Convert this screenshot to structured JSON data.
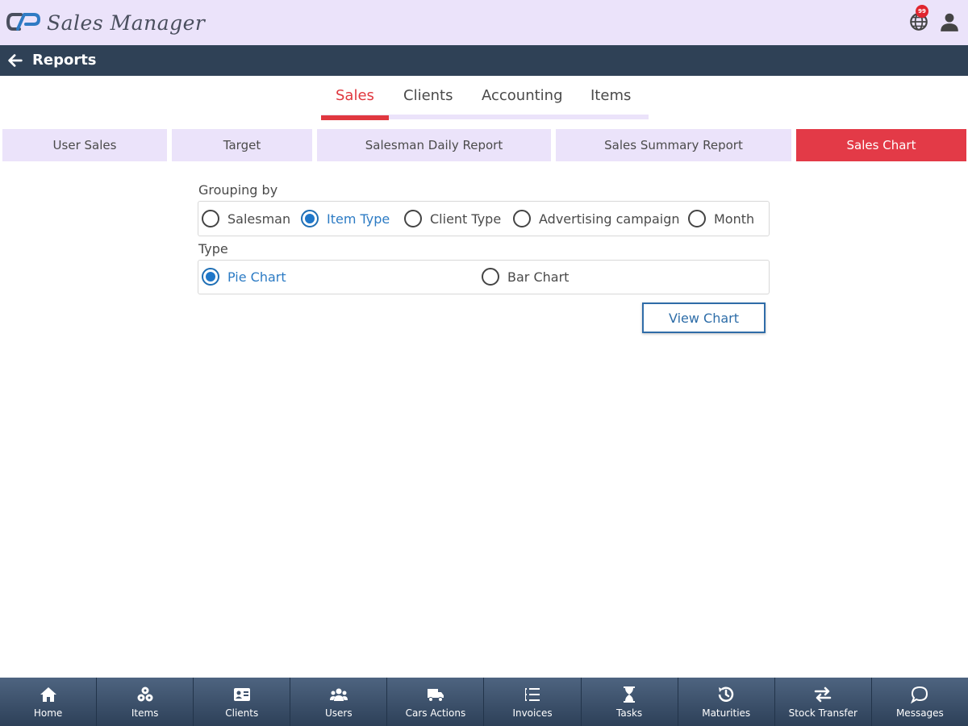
{
  "app": {
    "title": "Sales Manager",
    "notification_count": "99"
  },
  "header": {
    "title": "Reports"
  },
  "main_tabs": [
    {
      "label": "Sales",
      "active": true
    },
    {
      "label": "Clients",
      "active": false
    },
    {
      "label": "Accounting",
      "active": false
    },
    {
      "label": "Items",
      "active": false
    }
  ],
  "sub_tabs": [
    {
      "label": "User Sales",
      "active": false
    },
    {
      "label": "Target",
      "active": false
    },
    {
      "label": "Salesman Daily Report",
      "active": false
    },
    {
      "label": "Sales Summary Report",
      "active": false
    },
    {
      "label": "Sales Chart",
      "active": true
    }
  ],
  "grouping": {
    "label": "Grouping by",
    "options": [
      "Salesman",
      "Item Type",
      "Client Type",
      "Advertising campaign",
      "Month"
    ],
    "selected": "Item Type"
  },
  "type": {
    "label": "Type",
    "options": [
      "Pie Chart",
      "Bar Chart"
    ],
    "selected": "Pie Chart"
  },
  "view_button": "View Chart",
  "bottom_nav": [
    {
      "label": "Home",
      "icon": "home-icon"
    },
    {
      "label": "Items",
      "icon": "items-icon"
    },
    {
      "label": "Clients",
      "icon": "id-card-icon"
    },
    {
      "label": "Users",
      "icon": "users-icon"
    },
    {
      "label": "Cars Actions",
      "icon": "truck-icon"
    },
    {
      "label": "Invoices",
      "icon": "list-icon"
    },
    {
      "label": "Tasks",
      "icon": "hourglass-icon"
    },
    {
      "label": "Maturities",
      "icon": "history-icon"
    },
    {
      "label": "Stock Transfer",
      "icon": "transfer-icon"
    },
    {
      "label": "Messages",
      "icon": "message-icon"
    }
  ],
  "colors": {
    "accent": "#e33a47",
    "header": "#2f4156",
    "appbar": "#ebe3fa",
    "link_blue": "#2c7bc4"
  }
}
